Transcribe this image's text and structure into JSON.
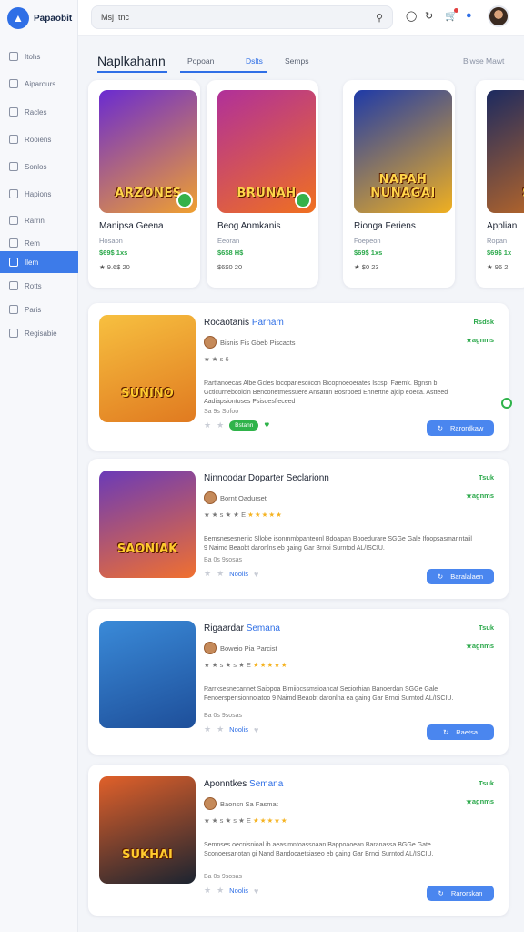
{
  "app": {
    "brand": "Papaobit"
  },
  "sidebar": {
    "items": [
      {
        "label": "Itohs",
        "icon": "home-icon"
      },
      {
        "label": "Aiparours",
        "icon": "grid-icon"
      },
      {
        "label": "Racles",
        "icon": "folder-icon"
      },
      {
        "label": "Rooiens",
        "icon": "calendar-icon"
      },
      {
        "label": "Sonlos",
        "icon": "list-icon"
      },
      {
        "label": "Hapions",
        "icon": "chart-icon"
      },
      {
        "label": "Rarrin",
        "icon": "gift-icon"
      },
      {
        "label": "Rem",
        "icon": "chat-icon"
      },
      {
        "label": "Ilem",
        "icon": "box-icon",
        "active": true
      },
      {
        "label": "Rotts",
        "icon": "star-icon"
      },
      {
        "label": "Paris",
        "icon": "tag-icon"
      },
      {
        "label": "Regisabie",
        "icon": "settings-icon"
      }
    ]
  },
  "topbar": {
    "search_value": "Msj  tnc"
  },
  "section": {
    "title": "Naplkahann",
    "tabs": [
      "Popoan",
      "Dslts",
      "Semps"
    ],
    "active_tab": 1,
    "see_more": "Biwse Mawt"
  },
  "featured": [
    {
      "art": "ARZONES",
      "name": "Manipsa Geena",
      "sub": "Hosaon",
      "price": "$69$ 1xs",
      "meta": "★ 9.6$ 20",
      "colors": [
        "#6a2bd1",
        "#f0a030"
      ]
    },
    {
      "art": "BRUNAH",
      "name": "Beog Anmkanis",
      "sub": "Eeoran",
      "price": "$6$8 H$",
      "meta": "$6$0 20",
      "colors": [
        "#b0309a",
        "#f07020"
      ]
    },
    {
      "art": "NAPAH NUNAGAI",
      "name": "Rionga Feriens",
      "sub": "Foepeon",
      "price": "$69$ 1xs",
      "meta": "★ $0 23",
      "colors": [
        "#1e3aa8",
        "#f0b020"
      ]
    },
    {
      "art": "SAE",
      "name": "Applian",
      "sub": "Ropan",
      "price": "$69$ 1x",
      "meta": "★ 96 2",
      "colors": [
        "#1c2a60",
        "#d07020"
      ]
    }
  ],
  "list": [
    {
      "art": "SUNINO",
      "title": "Rocaotanis",
      "title_accent": "Parnam",
      "tag": "Rsdsk",
      "tag2": "★agnms",
      "dev": "Bisnis Fis Gbeb Piscacts",
      "rating_prefix": "★ ★ s 6",
      "stars": "",
      "desc": "Rartfanoecas Albe Gcles locopanesciicon Bicopnoeoerates Iscsp. Faemk. Bgnsn b Gcticurnebcoicin Benconetmessuere Ansatun Bosrpoed Ehnertne ajcip eoeca. Astteed Aadiapsiontoses Psisoesfieceed",
      "meta": "Sa  9s  Sofoo",
      "pill": "Bstann",
      "button": "Rarordkaw",
      "colors": [
        "#f7c040",
        "#e07a20"
      ]
    },
    {
      "art": "SAONIAK",
      "title": "Ninnoodar Doparter Seclarionn",
      "title_accent": "",
      "tag": "Tsuk",
      "tag2": "★agnms",
      "dev": "Bornt Oadurset",
      "rating_prefix": "★ ★ s ★ ★ E",
      "stars": "★★★★★",
      "desc": "Bemsnesesnenic Sllobe isonmmbpanteonl Bdoapan Booedurare SGGe Gale Ifoopsasmanntaiil 9 Naimd Beaobt daronlns eb gaing Gar Brnoi Surntod AL/ISCIU.",
      "meta": "Ba 0s 9sosas",
      "pill": "",
      "button": "Baralalaen",
      "colors": [
        "#6a3ab8",
        "#f07030"
      ]
    },
    {
      "art": "",
      "title": "Rigaardar",
      "title_accent": "Semana",
      "tag": "Tsuk",
      "tag2": "★agnms",
      "dev": "Boweio Pia Parcist",
      "rating_prefix": "★ ★ s ★ s ★ E",
      "stars": "★★★★★",
      "desc": "Rarrksesnecannet Saiopoa Bimiiocssmsioancat Seciorhian Banoerdan SGGe Gale Fenoerspensionnoiatoo 9 Naimd Beaobt daronlna ea gaing Gar Brnoi Surntod AL/ISCIU.",
      "meta": "Ba 0s 9sosas",
      "pill": "",
      "button": "Raetsa",
      "colors": [
        "#3a8ad8",
        "#1e4f9a"
      ]
    },
    {
      "art": "SUKHAI",
      "title": "Aponntkes",
      "title_accent": "Semana",
      "tag": "Tsuk",
      "tag2": "★agnms",
      "dev": "Baonsn Sa Fasmat",
      "rating_prefix": "★ ★ s ★ s ★ E",
      "stars": "★★★★★",
      "desc": "Semnses oecnisnioal ib aeasimntoassoaan Bappoaoean Baranassa BGGe Gate Sconoersanotan gi Nand Bandocaetsiaseo eb gaing Gar Brnoi Surntod AL/ISCIU.",
      "meta": "Ba 0s 9sosas",
      "pill": "",
      "button": "Rarorskan",
      "colors": [
        "#e0602a",
        "#1c2430"
      ]
    }
  ],
  "common": {
    "link": "Noolis"
  }
}
